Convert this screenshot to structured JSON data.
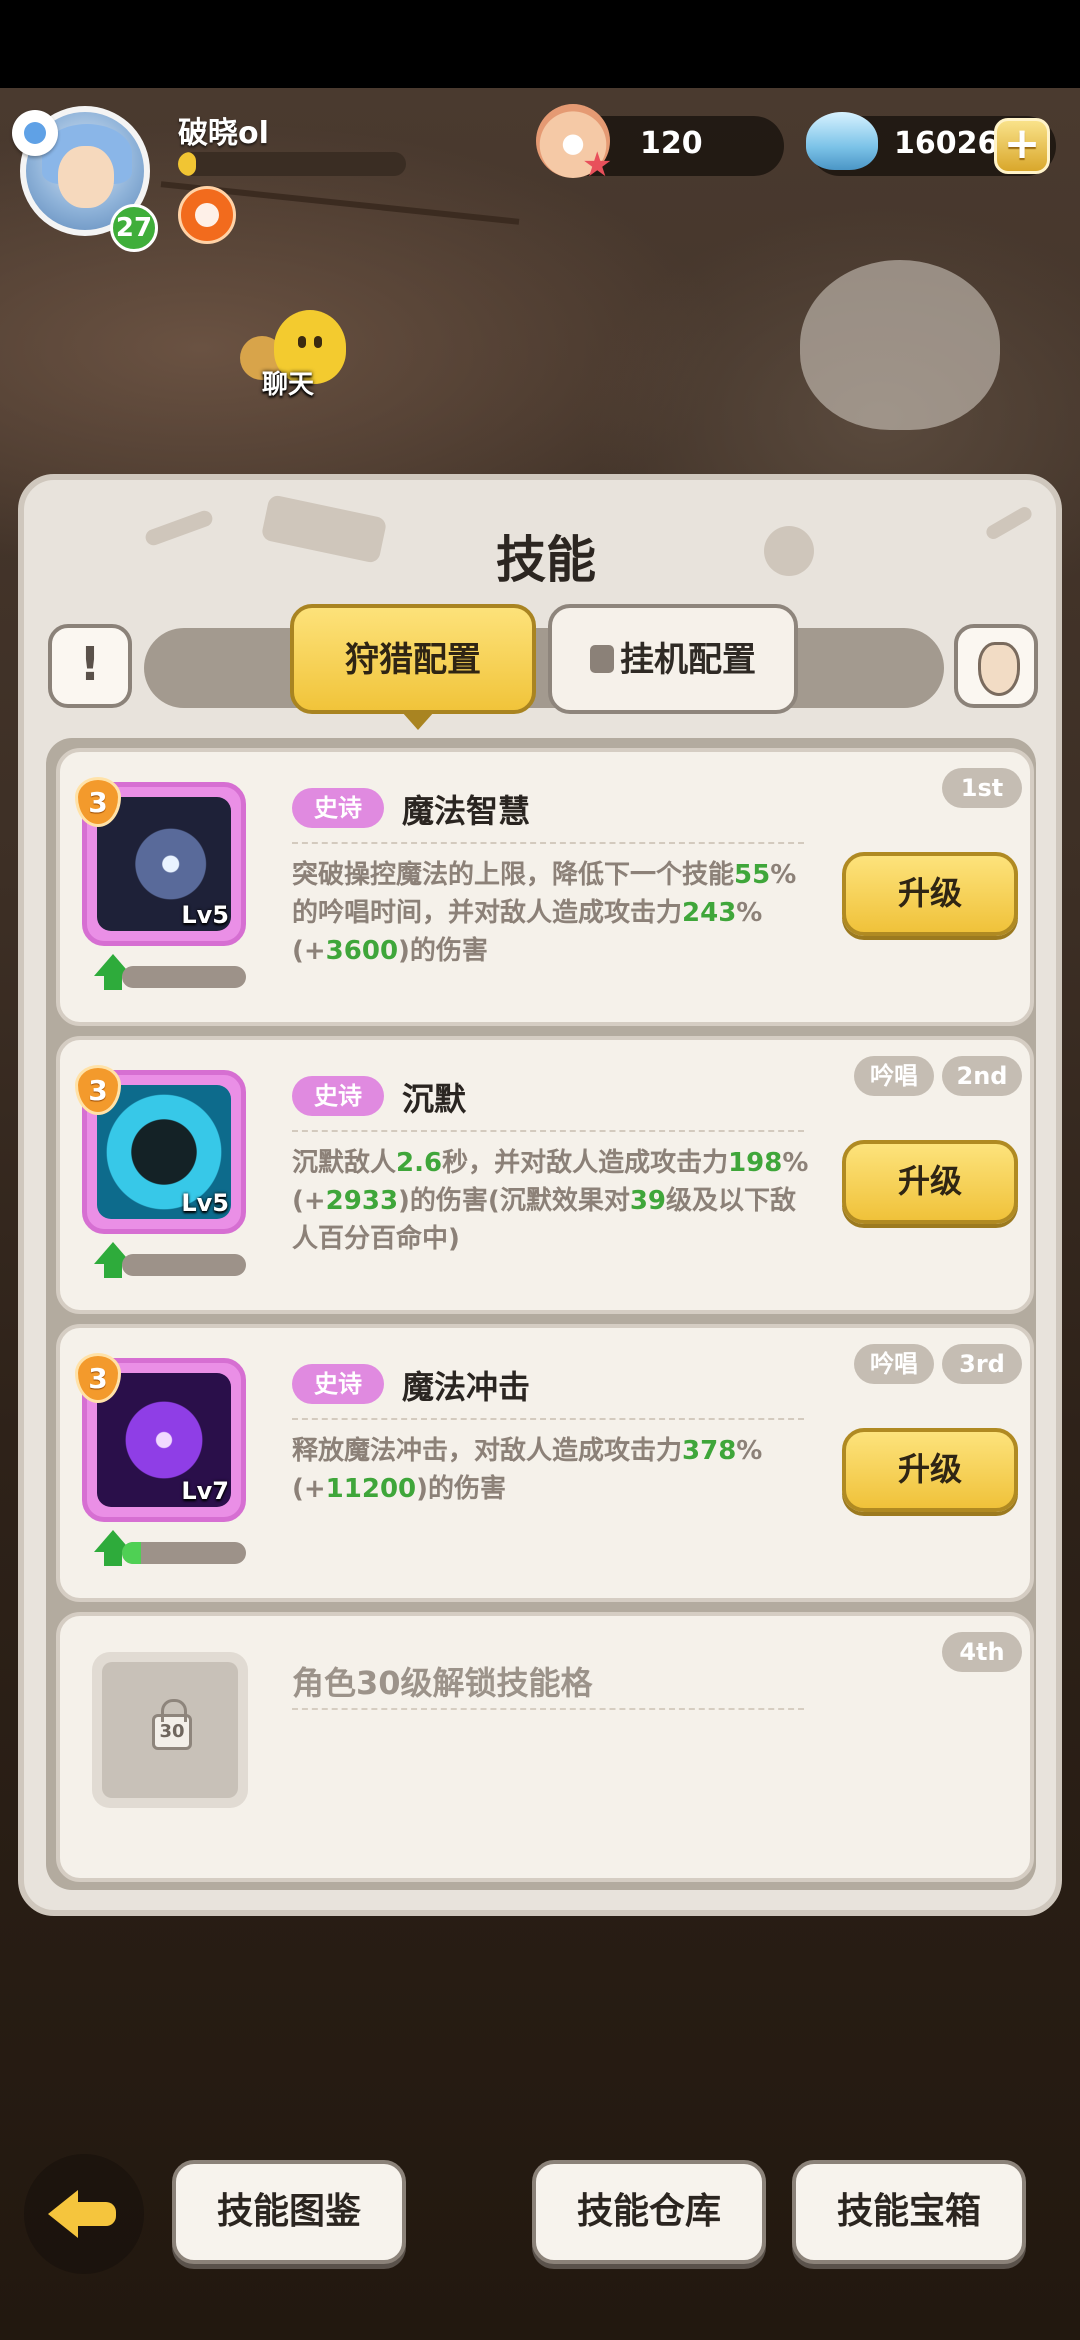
{
  "header": {
    "player_name": "破晓ol",
    "level": "27",
    "exp_progress": 0.08,
    "chat_label": "聊天",
    "pearls": "120",
    "shells": "16026"
  },
  "panel": {
    "title": "技能",
    "tabs": [
      {
        "label": "狩猎配置",
        "active": true,
        "locked": false
      },
      {
        "label": "挂机配置",
        "active": false,
        "locked": true
      }
    ],
    "info_button": "!"
  },
  "skills": [
    {
      "order": "1st",
      "chant": "",
      "rarity": "史诗",
      "name": "魔法智慧",
      "rank": "3",
      "level": "Lv5",
      "upgrade_progress": 0.0,
      "desc": [
        {
          "t": "突破操控魔法的上限，降低下一个技能",
          "g": false
        },
        {
          "t": "55",
          "g": true
        },
        {
          "t": "%的吟唱时间，并对敌人造成攻击力",
          "g": false
        },
        {
          "t": "243",
          "g": true
        },
        {
          "t": "%(+",
          "g": false
        },
        {
          "t": "3600",
          "g": true
        },
        {
          "t": ")的伤害",
          "g": false
        }
      ],
      "button": "升级"
    },
    {
      "order": "2nd",
      "chant": "吟唱",
      "rarity": "史诗",
      "name": "沉默",
      "rank": "3",
      "level": "Lv5",
      "upgrade_progress": 0.0,
      "desc": [
        {
          "t": "沉默敌人",
          "g": false
        },
        {
          "t": "2.6",
          "g": true
        },
        {
          "t": "秒，并对敌人造成攻击力",
          "g": false
        },
        {
          "t": "198",
          "g": true
        },
        {
          "t": "%(+",
          "g": false
        },
        {
          "t": "2933",
          "g": true
        },
        {
          "t": ")的伤害(沉默效果对",
          "g": false
        },
        {
          "t": "39",
          "g": true
        },
        {
          "t": "级及以下敌人百分百命中)",
          "g": false
        }
      ],
      "button": "升级"
    },
    {
      "order": "3rd",
      "chant": "吟唱",
      "rarity": "史诗",
      "name": "魔法冲击",
      "rank": "3",
      "level": "Lv7",
      "upgrade_progress": 0.15,
      "desc": [
        {
          "t": "释放魔法冲击，对敌人造成攻击力",
          "g": false
        },
        {
          "t": "378",
          "g": true
        },
        {
          "t": "%(+",
          "g": false
        },
        {
          "t": "11200",
          "g": true
        },
        {
          "t": ")的伤害",
          "g": false
        }
      ],
      "button": "升级"
    }
  ],
  "locked_slot": {
    "order": "4th",
    "text": "角色30级解锁技能格",
    "unlock_level": "30"
  },
  "bottom": {
    "btn1": "技能图鉴",
    "btn2": "技能仓库",
    "btn3": "技能宝箱"
  },
  "colors": {
    "accent_yellow": "#f1c43a",
    "rarity_epic": "#e08ae0",
    "value_green": "#3fa63a"
  }
}
